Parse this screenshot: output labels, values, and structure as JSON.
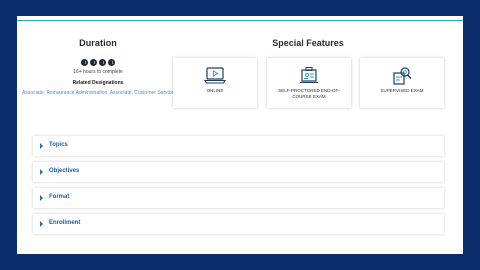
{
  "duration": {
    "title": "Duration",
    "hours": "16+ hours to complete",
    "related_label": "Related Designations",
    "designations": "Associate, Reinsurance Administration, Associate, Customer Service"
  },
  "special_features": {
    "title": "Special Features",
    "items": [
      {
        "label": "ONLINE",
        "icon": "laptop-play-icon"
      },
      {
        "label": "SELF-PROCTORED END-OF-COURSE EXAM",
        "icon": "exam-screen-icon"
      },
      {
        "label": "SUPERVISED EXAM",
        "icon": "supervised-exam-icon"
      }
    ]
  },
  "accordion": {
    "items": [
      "Topics",
      "Objectives",
      "Format",
      "Enrollment"
    ]
  },
  "colors": {
    "background": "#0a2d6b",
    "accent": "#1a70c2",
    "teal_rule": "#2bb3b1"
  }
}
